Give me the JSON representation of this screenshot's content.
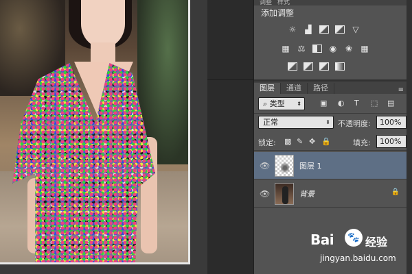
{
  "adjustments": {
    "tabs": [
      "调整",
      "样式"
    ],
    "title": "添加调整",
    "icons_row1": [
      "brightness-icon",
      "levels-icon",
      "curves-icon",
      "exposure-icon",
      "vibrance-icon"
    ],
    "icons_row2": [
      "hue-saturation-icon",
      "color-balance-icon",
      "black-white-icon",
      "photo-filter-icon",
      "channel-mixer-icon",
      "color-lookup-icon"
    ],
    "icons_row3": [
      "invert-icon",
      "posterize-icon",
      "threshold-icon",
      "gradient-map-icon"
    ]
  },
  "layers": {
    "tabs": [
      "图层",
      "通道",
      "路径"
    ],
    "filter_kind": "类型",
    "blend_mode": "正常",
    "opacity_label": "不透明度:",
    "opacity_value": "100%",
    "lock_label": "锁定:",
    "fill_label": "填充:",
    "fill_value": "100%",
    "items": [
      {
        "name": "图层 1",
        "selected": true
      },
      {
        "name": "背景",
        "selected": false,
        "locked": true
      }
    ]
  },
  "watermark": {
    "brand": "Bai",
    "brand_cn": "经验",
    "url": "jingyan.baidu.com"
  }
}
